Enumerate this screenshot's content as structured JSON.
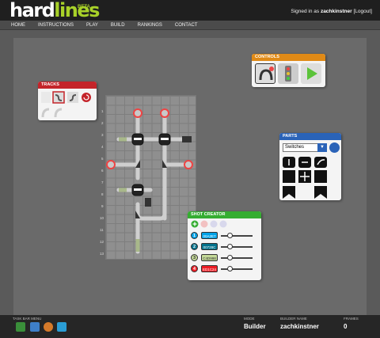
{
  "header": {
    "logo_hard": "hard",
    "logo_lines": "lines",
    "logo_beta": "BETA",
    "signed_in_prefix": "Signed in as ",
    "username": "zachkinstner",
    "logout": "[Logout]"
  },
  "nav": {
    "items": [
      {
        "label": "HOME"
      },
      {
        "label": "INSTRUCTIONS"
      },
      {
        "label": "PLAY"
      },
      {
        "label": "BUILD"
      },
      {
        "label": "RANKINGS"
      },
      {
        "label": "CONTACT"
      }
    ]
  },
  "board": {
    "row_numbers": [
      "1",
      "2",
      "3",
      "4",
      "5",
      "6",
      "7",
      "8",
      "9",
      "10",
      "11",
      "12",
      "13"
    ]
  },
  "panels": {
    "tracks": {
      "title": "TRACKS"
    },
    "controls": {
      "title": "CONTROLS"
    },
    "parts": {
      "title": "PARTS",
      "selected": "Switches"
    },
    "shot_creator": {
      "title": "SHOT CREATOR",
      "shots": [
        {
          "num": "1",
          "hex": "00A2E7",
          "color": "#00a2e7"
        },
        {
          "num": "2",
          "hex": "00728C",
          "color": "#00728c"
        },
        {
          "num": "3",
          "hex": "C4D998",
          "color": "#c4d998"
        },
        {
          "num": "4",
          "hex": "ED1C24",
          "color": "#ed1c24"
        }
      ]
    }
  },
  "taskbar": {
    "menu_label": "TASK BAR MENU",
    "mode_label": "MODE",
    "mode_value": "Builder",
    "builder_label": "BUILDER NAME",
    "builder_value": "zachkinstner",
    "frames_label": "FRAMES",
    "frames_value": "0"
  }
}
